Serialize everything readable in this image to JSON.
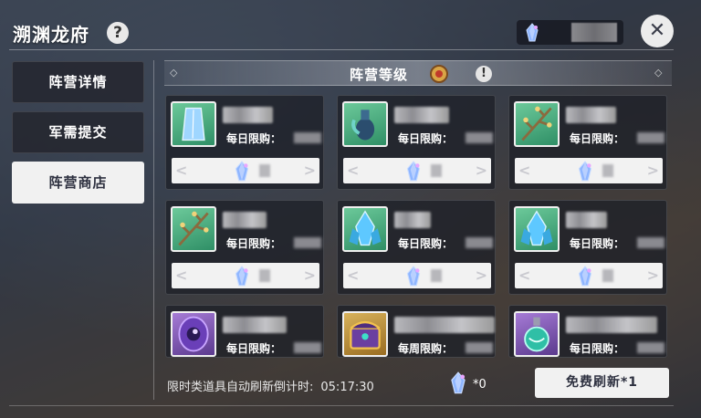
{
  "header": {
    "title": "溯渊龙府",
    "help_icon": "?",
    "currency_icon": "crystal-icon",
    "close_icon": "✕"
  },
  "sidebar": {
    "tabs": [
      {
        "label": "阵营详情",
        "active": false
      },
      {
        "label": "军需提交",
        "active": false
      },
      {
        "label": "阵营商店",
        "active": true
      }
    ]
  },
  "level_bar": {
    "label": "阵营等级",
    "info_icon": "!"
  },
  "items": [
    {
      "limit_label": "每日限购：",
      "icon": "ice-crystal-icon",
      "bg": "green"
    },
    {
      "limit_label": "每日限购：",
      "icon": "vase-icon",
      "bg": "green"
    },
    {
      "limit_label": "每日限购：",
      "icon": "branch-icon",
      "bg": "green"
    },
    {
      "limit_label": "每日限购：",
      "icon": "branch-icon",
      "bg": "green"
    },
    {
      "limit_label": "每日限购：",
      "icon": "crystal-cluster-icon",
      "bg": "green"
    },
    {
      "limit_label": "每日限购：",
      "icon": "crystal-cluster-icon",
      "bg": "green"
    },
    {
      "limit_label": "每日限购：",
      "icon": "eye-orb-icon",
      "bg": "purple"
    },
    {
      "limit_label": "每周限购：",
      "icon": "treasure-chest-icon",
      "bg": "gold"
    },
    {
      "limit_label": "每日限购：",
      "icon": "potion-icon",
      "bg": "purple"
    }
  ],
  "footer": {
    "timer_label": "限时类道具自动刷新倒计时:",
    "timer_value": "05:17:30",
    "currency_count": "*0",
    "refresh_label": "免费刷新*1"
  },
  "colors": {
    "panel": "#1e2028",
    "button_light": "#f1f1f1",
    "icon_green": "#3fae7f",
    "icon_purple": "#7b52b8"
  }
}
